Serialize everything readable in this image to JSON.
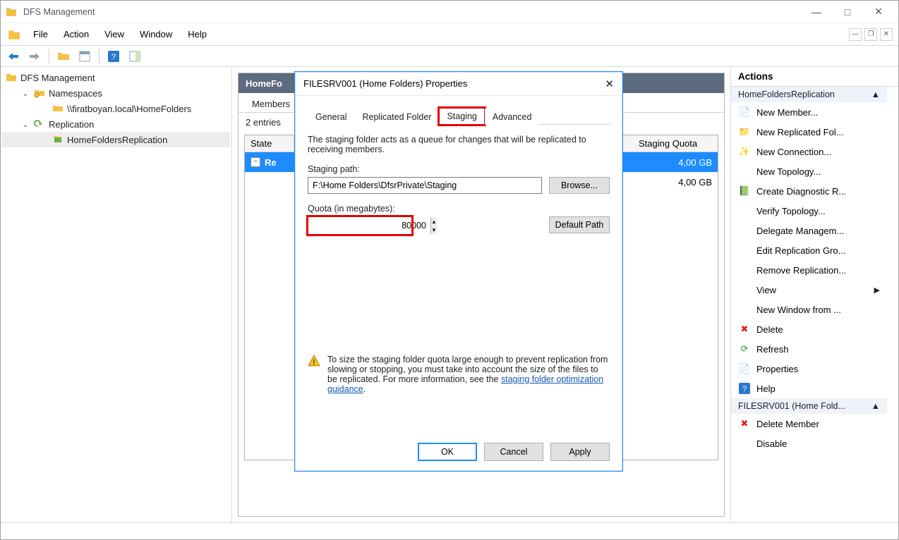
{
  "window": {
    "title": "DFS Management"
  },
  "menu": {
    "file": "File",
    "action": "Action",
    "view": "View",
    "window": "Window",
    "help": "Help"
  },
  "tree": {
    "root": "DFS Management",
    "namespaces": "Namespaces",
    "namespace_path": "\\\\firatboyan.local\\HomeFolders",
    "replication": "Replication",
    "replication_group": "HomeFoldersReplication"
  },
  "center": {
    "header": "HomeFo",
    "tab_members": "Members",
    "entries": "2 entries",
    "columns": {
      "state": "State",
      "staging_quota": "Staging Quota"
    },
    "rows": [
      {
        "state": "Re",
        "quota": "4,00 GB",
        "selected": true
      },
      {
        "state": "",
        "quota": "4,00 GB",
        "selected": false
      }
    ]
  },
  "actions": {
    "header": "Actions",
    "group1": "HomeFoldersReplication",
    "items1": [
      "New Member...",
      "New Replicated Fol...",
      "New Connection...",
      "New Topology...",
      "Create Diagnostic R...",
      "Verify Topology...",
      "Delegate Managem...",
      "Edit Replication Gro...",
      "Remove Replication...",
      "View",
      "New Window from ...",
      "Delete",
      "Refresh",
      "Properties",
      "Help"
    ],
    "group2": "FILESRV001 (Home Fold...",
    "items2": [
      "Delete Member",
      "Disable"
    ]
  },
  "dialog": {
    "title": "FILESRV001 (Home Folders) Properties",
    "tabs": {
      "general": "General",
      "replicated": "Replicated Folder",
      "staging": "Staging",
      "advanced": "Advanced"
    },
    "desc": "The staging folder acts as a queue for changes that will be replicated to receiving members.",
    "staging_path_label": "Staging path:",
    "staging_path": "F:\\Home Folders\\DfsrPrivate\\Staging",
    "browse": "Browse...",
    "quota_label": "Quota (in megabytes):",
    "quota_value": "80000",
    "default_path": "Default Path",
    "warn": "To size the staging folder quota large enough to prevent replication from slowing or stopping, you must take into account the size of the files to be replicated. For more information, see the ",
    "warn_link": "staging folder optimization guidance",
    "warn_after": ".",
    "ok": "OK",
    "cancel": "Cancel",
    "apply": "Apply"
  }
}
